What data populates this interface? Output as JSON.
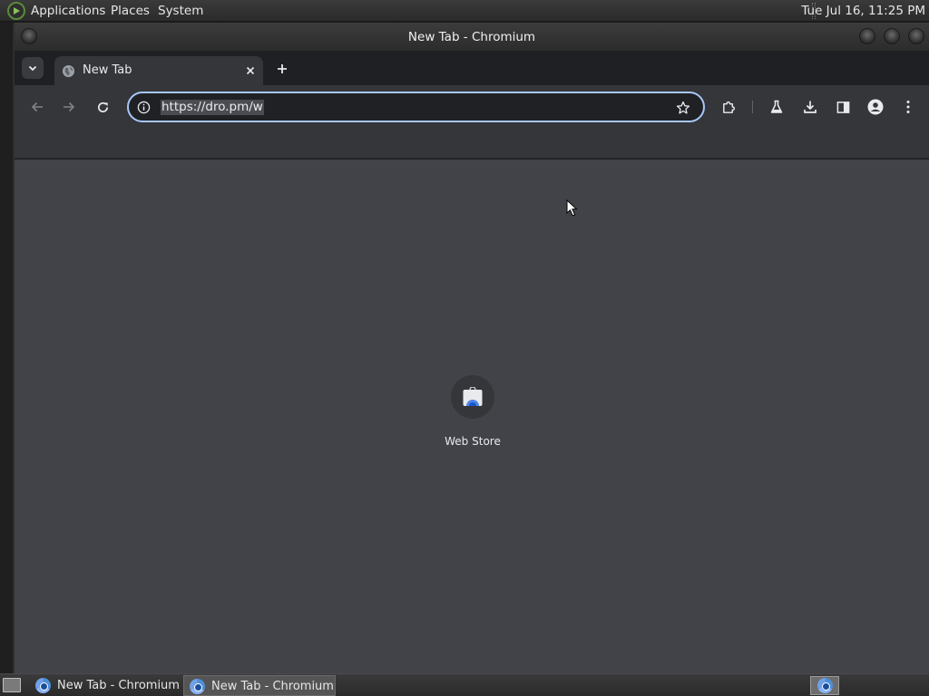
{
  "top_panel": {
    "menus": [
      "Applications",
      "Places",
      "System"
    ],
    "clock": "Tue Jul 16, 11:25 PM"
  },
  "window": {
    "title": "New Tab - Chromium"
  },
  "tabs": [
    {
      "label": "New Tab",
      "active": true
    }
  ],
  "omnibox": {
    "url": "https://dro.pm/w",
    "selected": true
  },
  "shortcuts": [
    {
      "label": "Web Store",
      "icon": "web-store-icon"
    }
  ],
  "taskbar": {
    "items": [
      {
        "label": "New Tab - Chromium",
        "active": false
      },
      {
        "label": "New Tab - Chromium",
        "active": true
      }
    ]
  },
  "colors": {
    "accent": "#a8c7fa",
    "page_background": "#424348",
    "toolbar": "#35363a"
  }
}
